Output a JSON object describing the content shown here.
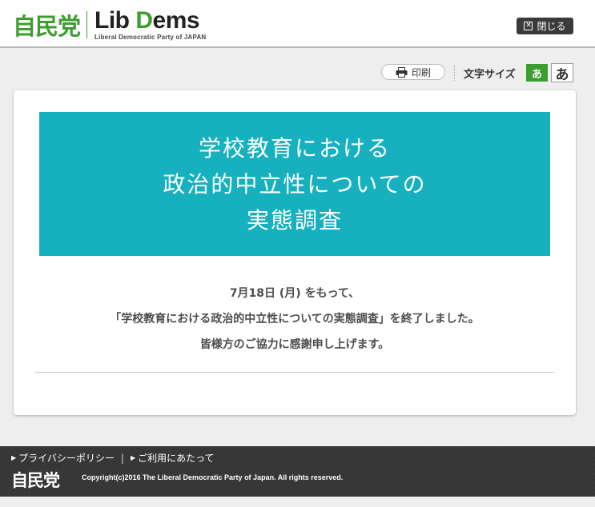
{
  "header": {
    "logo_jp": "自民党",
    "logo_en_prefix": "Lib ",
    "logo_en_d": "D",
    "logo_en_rest": "ems",
    "logo_en_sub": "Liberal Democratic Party of JAPAN",
    "close_label": "閉じる",
    "close_icon": "close-box-icon"
  },
  "tools": {
    "print_label": "印刷",
    "font_size_label": "文字サイズ",
    "font_small_label": "あ",
    "font_large_label": "あ",
    "accent_color": "#3d9e30"
  },
  "banner": {
    "line1": "学校教育における",
    "line2": "政治的中立性についての",
    "line3": "実態調査",
    "color": "#16b0be"
  },
  "message": {
    "line1": "7月18日 (月) をもって、",
    "line2": "「学校教育における政治的中立性についての実態調査」を終了しました。",
    "line3": "皆様方のご協力に感謝申し上げます。"
  },
  "footer": {
    "link1": "プライバシーポリシー",
    "separator": "|",
    "link2": "ご利用にあたって",
    "logo": "自民党",
    "copyright": "Copyright(c)2016 The Liberal Democratic Party of Japan. All rights reserved."
  }
}
